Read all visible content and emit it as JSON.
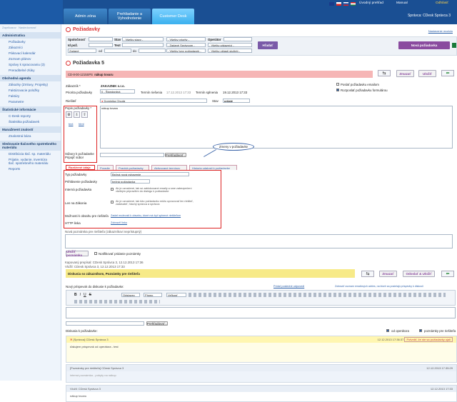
{
  "header": {
    "flags": [
      "#1a3a8a",
      "#d22",
      "#fff",
      "#1a7a3a",
      "#1b4fa8"
    ],
    "top_links": [
      "Úvodný prehľad",
      "Manual",
      "Odhlásiť"
    ],
    "tabs": [
      {
        "label": "Admin zóna"
      },
      {
        "label": "Prehliadanie a Vyhodnotenie"
      },
      {
        "label": "Customer Desk"
      }
    ],
    "user": "Správca: CDesk Správca 3"
  },
  "sidebar": {
    "top_links": [
      "Zapríkazov",
      "Nasledovnosť"
    ],
    "sections": [
      {
        "title": "Administrativa",
        "items": [
          "Požiadavky",
          "Zákazníci",
          "Pákovací kalendár",
          "Zoznam plánov",
          "Správy k spracovaniu (3)",
          "Preraditelné zlúky"
        ]
      },
      {
        "title": "Obchodná agenda",
        "items": [
          "Zákazky (Zmluvy, Projekty)",
          "Faktúrovacie položky",
          "Faktúry",
          "Parametre"
        ]
      },
      {
        "title": "Štatistické informácie",
        "items": [
          "C-Desk reporty",
          "Štatistika požiadavek"
        ]
      },
      {
        "title": "Manažment znalostí",
        "items": [
          "Znalostná báza"
        ]
      },
      {
        "title": "Sledovanie tlačového spotrebného materiálu",
        "items": [
          "Distribúcia tlač. sp. materiálu",
          "Prijatie, vydanie, inventúra tlač. spotrebného materiálu",
          "Reports"
        ]
      }
    ]
  },
  "requests": {
    "title": "Požiadavky",
    "settings_link": "Nastavenie modulu",
    "filters": {
      "company_label": "Spoločnosť",
      "status_label": "Stav",
      "operator_label": "Operátor",
      "reqnum_label": "Id pož.",
      "text_label": "Text",
      "type_label": "Zadané",
      "od": "od",
      "do": "do",
      "status_value": "- Všetky stavy -",
      "priority_value": "- Všetky priority -",
      "operator_value": "- Všetky osoby -",
      "admin_value": "- Zadané Správcom -",
      "filter_value": "- Všetky zákazníci -",
      "types_value": "- Všetky typy požiadavek -",
      "cat_value": "- Všetky oblasti služieb -",
      "date_type": "Zadané"
    },
    "search_button": "Hľadať",
    "new_button": "Nová požiadavka"
  },
  "detail": {
    "title": "Požiadavka 5",
    "subject_code": "CD-8-00-1215SPS",
    "subject": "nákup tovaru",
    "delete": "Zmazať",
    "save": "Uložiť",
    "customer_label": "Zákazník *",
    "customer_value": "ZAKAZNIK s.r.o.",
    "priority_label": "Priorita požiadavky",
    "priority_value": "0 - Štandardná",
    "deadline_label": "Termín riešenia",
    "deadline_value": "17.12.2013 17:33",
    "solved_label": "Termín splnenia",
    "solved_value": "19.12.2013 17:33",
    "email_check": "Poslať požiadavku emailom",
    "fw_check": "Rozposlať požiadavku formulárou",
    "assignee_label": "Riešiteľ",
    "assignee_value": "Dominika Chudá",
    "status_label": "Stav",
    "status_value": "prijaté",
    "desc_label": "Popis požiadavky *",
    "desc_text": "nákup tovaru",
    "desc_links": [
      "text",
      "html"
    ],
    "files_label": "Súbory k požiadavke Pripojiť súbor",
    "browse": "Prehľadávať...",
    "callout": "Zmeny v požiadavke",
    "tabs": [
      "Rozšírené údaje",
      "Poradie",
      "Pravidá požiadavky",
      "Aktivované termínov",
      "Historia udalosti k požiadavke"
    ],
    "ext": {
      "type_label": "Typ požiadavky",
      "type_value": "Rozšírené údaje",
      "type_select": "Bežná nová vybavenie",
      "request_label": "Prihlásenie požiadavky",
      "request_value": "bežná požiadavka",
      "internal_label": "Interná požiadavka",
      "internal_text": "Ak je označené, tak sú zablokované emaily a sme zabezpečení všetkým pripravitím do dialógu k požiadavke",
      "onlyname_label": "Len na Zákonia",
      "onlyname_text": "Ak je označené, tak túto požiadavku môžu upravovať len riešiteľ, zadávateľ, hlavný správca a správca",
      "possible_label": "Možnosti k obsahu pre riešiteľa",
      "possible_link": "Zadať možnosti k obsahu, ktoré má byť splnené riešiteľom",
      "http_label": "HTTP linka",
      "http_link": "Zobraziť linku"
    },
    "note_label": "Nová poznámka pre riešiteľa (zákazníkovi neprístupný)",
    "save_note": "Uložiť poznámku",
    "notify_check": "Notifikovať pridanie poznámky",
    "created": "Kapovaný prepísal: CDesk Správca 3, 12.12.2013 17:36",
    "changed": "Vložil: CDesk Správca 3, 12.12.2013 17:33"
  },
  "dialog": {
    "bar_title": "Diskusia so zákazníkom, Poznámky pre riešiteľa",
    "delete": "Zmazať",
    "send_save": "Odoslať & Uložiť",
    "reply_link": "Pridať posledné odpovedi",
    "show_link": "Zobraziť zoznam emailových adries, na ktoré sa posielajú príspevky k diskusii",
    "new_label": "Nový príspevok do diskusie k požiadavke:",
    "format": "Odstavec",
    "font": "Písmo",
    "size": "Veľkosť písma",
    "browse": "Prehľadávať...",
    "list_label": "Diskusia k požiadavke:",
    "show_op": "od operátora",
    "show_res": "poznámky pre riešiteľa",
    "entries": [
      {
        "author": "[Správca] CDesk Správca 3",
        "time": "12.12.2013 17:36:37",
        "text": "ďakujem príspevok od operátora - test",
        "extra": "Potvrdiť, že ste sa požiadavky ujali"
      },
      {
        "author": "[Poznámky pre riešiteľa] CDesk Správca 3",
        "time": "12.12.2013 17:35:29",
        "text": "interná poznámka - pobyty na nákup"
      },
      {
        "author": "Vložil: CDesk Správca 3",
        "time": "12.12.2013 17:33",
        "text": "nákup tovaru"
      }
    ]
  }
}
